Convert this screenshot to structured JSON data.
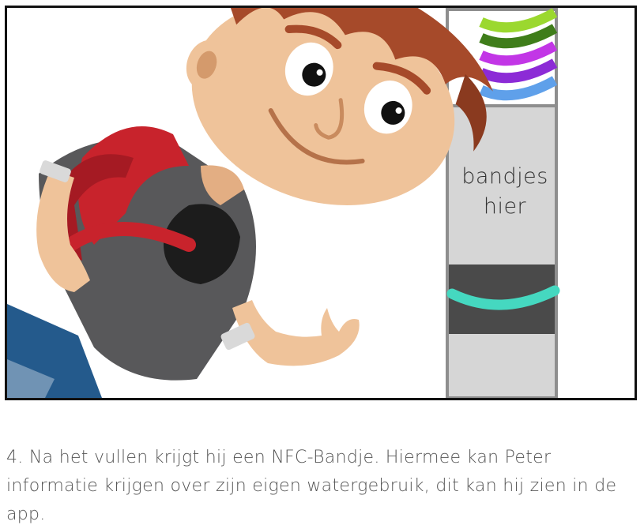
{
  "illustration": {
    "dispenser": {
      "label_line1": "bandjes",
      "label_line2": "hier"
    }
  },
  "caption": {
    "text": "4. Na het vullen krijgt hij een NFC-Bandje. Hiermee kan Peter informatie krijgen over zijn eigen watergebruik, dit kan hij zien in de app."
  },
  "colors": {
    "hair": "#a64a2a",
    "skin": "#efc39a",
    "backpack": "#c8232c",
    "shirt": "#58585a",
    "jeans": "#245a8c",
    "band_teal": "#45d8c0",
    "dispenser_body": "#d6d6d6"
  }
}
